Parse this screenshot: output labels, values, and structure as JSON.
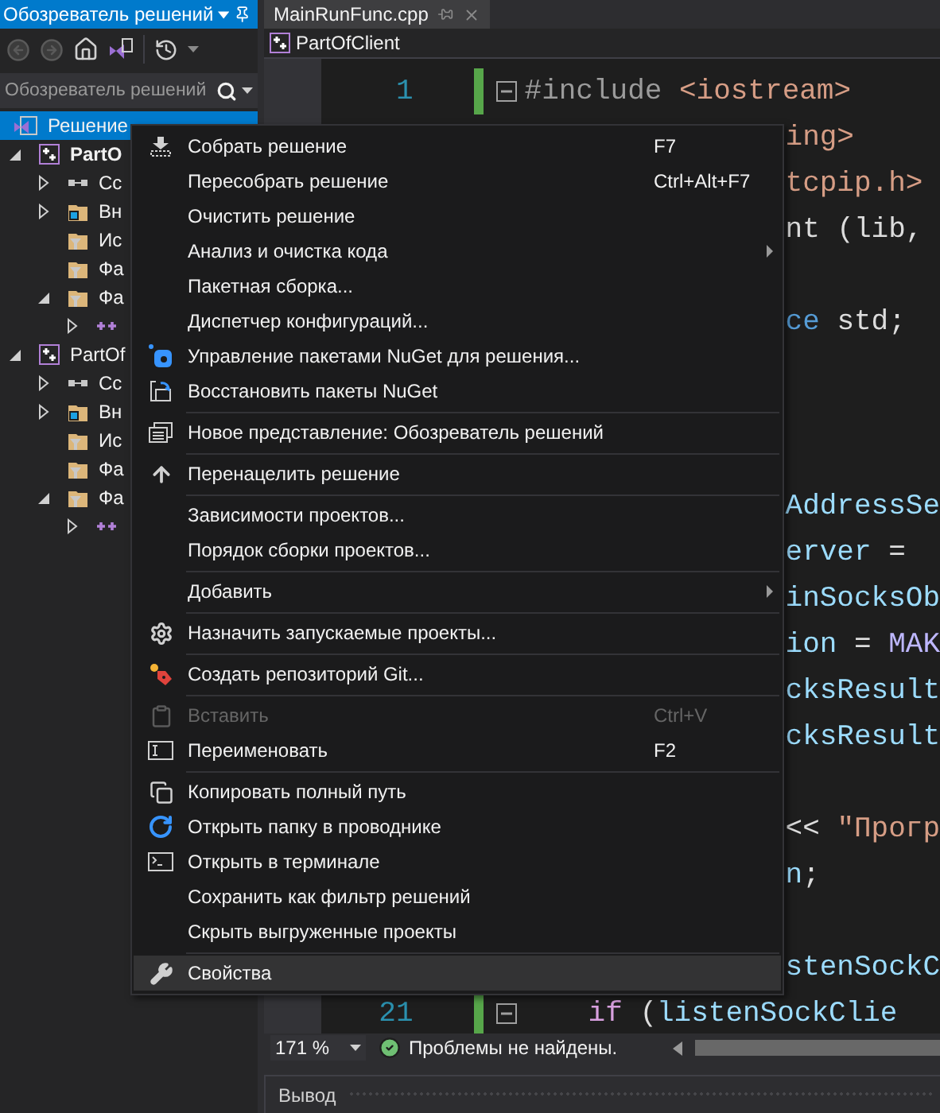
{
  "explorer": {
    "title": "Обозреватель решений",
    "search": {
      "placeholder": "Обозреватель решений"
    },
    "tree": [
      {
        "kind": "solution",
        "label": "Решение",
        "selected": true,
        "children": [
          {
            "kind": "project",
            "label": "PartO",
            "startup": true,
            "expanded": true,
            "selected": false,
            "children": [
              {
                "kind": "references",
                "label": "Сс",
                "expanded": false,
                "selected": false
              },
              {
                "kind": "external",
                "label": "Вн",
                "expanded": false,
                "selected": false
              },
              {
                "kind": "filter",
                "label": "Ис",
                "selected": false
              },
              {
                "kind": "filter",
                "label": "Фа",
                "selected": false
              },
              {
                "kind": "filter",
                "label": "Фа",
                "expanded": true,
                "selected": false,
                "children": [
                  {
                    "kind": "source",
                    "expanded": false,
                    "selected": false
                  }
                ]
              }
            ]
          },
          {
            "kind": "project",
            "label": "PartOf",
            "startup": false,
            "expanded": true,
            "selected": false,
            "children": [
              {
                "kind": "references",
                "label": "Сс",
                "expanded": false,
                "selected": false
              },
              {
                "kind": "external",
                "label": "Вн",
                "expanded": false,
                "selected": false
              },
              {
                "kind": "filter",
                "label": "Ис",
                "selected": false
              },
              {
                "kind": "filter",
                "label": "Фа",
                "selected": false
              },
              {
                "kind": "filter",
                "label": "Фа",
                "expanded": true,
                "selected": false,
                "children": [
                  {
                    "kind": "source",
                    "expanded": false,
                    "selected": false
                  }
                ]
              }
            ]
          }
        ]
      }
    ]
  },
  "editor": {
    "tab": {
      "label": "MainRunFunc.cpp"
    },
    "nav": {
      "project": "PartOfClient"
    },
    "lines": [
      {
        "kind": "full",
        "number": "1",
        "fold": true,
        "changed": true,
        "segments": [
          {
            "kind": "preprocessor",
            "text": "#include"
          },
          {
            "kind": "string",
            "text": " <iostream>"
          }
        ]
      },
      {
        "kind": "tail",
        "segments": [
          {
            "kind": "string",
            "text": "ing>"
          }
        ]
      },
      {
        "kind": "tail",
        "segments": [
          {
            "kind": "string",
            "text": "tcpip.h>"
          }
        ]
      },
      {
        "kind": "tail",
        "segments": [
          {
            "kind": "plain",
            "text": "nt (lib,"
          }
        ]
      },
      {
        "kind": "blank"
      },
      {
        "kind": "tail",
        "segments": [
          {
            "kind": "keyword",
            "text": "ce"
          },
          {
            "kind": "plain",
            "text": " std;"
          }
        ]
      },
      {
        "kind": "blank"
      },
      {
        "kind": "blank"
      },
      {
        "kind": "blank"
      },
      {
        "kind": "tail",
        "segments": [
          {
            "kind": "variable",
            "text": "AddressSe"
          }
        ]
      },
      {
        "kind": "tail",
        "segments": [
          {
            "kind": "variable",
            "text": "erver"
          },
          {
            "kind": "plain",
            "text": " ="
          }
        ]
      },
      {
        "kind": "tail",
        "segments": [
          {
            "kind": "variable",
            "text": "inSocksOb"
          }
        ]
      },
      {
        "kind": "tail",
        "segments": [
          {
            "kind": "variable",
            "text": "ion"
          },
          {
            "kind": "plain",
            "text": " = "
          },
          {
            "kind": "macro",
            "text": "MAK"
          }
        ]
      },
      {
        "kind": "tail",
        "segments": [
          {
            "kind": "variable",
            "text": "cksResult"
          }
        ]
      },
      {
        "kind": "tail",
        "segments": [
          {
            "kind": "variable",
            "text": "cksResult"
          }
        ]
      },
      {
        "kind": "blank"
      },
      {
        "kind": "tail",
        "segments": [
          {
            "kind": "plain",
            "text": "<< "
          },
          {
            "kind": "string",
            "text": "\"Прогр"
          }
        ]
      },
      {
        "kind": "tail",
        "segments": [
          {
            "kind": "variable",
            "text": "n"
          },
          {
            "kind": "plain",
            "text": ";"
          }
        ]
      },
      {
        "kind": "blank"
      },
      {
        "kind": "tail",
        "segments": [
          {
            "kind": "variable",
            "text": "stenSockC"
          }
        ]
      },
      {
        "kind": "indented",
        "number": "21",
        "fold": true,
        "changed": true,
        "segments": [
          {
            "kind": "control",
            "text": "if"
          },
          {
            "kind": "plain",
            "text": " ("
          },
          {
            "kind": "variable",
            "text": "listenSockClie"
          }
        ]
      }
    ],
    "status": {
      "zoom": "171 %",
      "issues": "Проблемы не найдены."
    }
  },
  "output": {
    "title": "Вывод"
  },
  "context_menu": {
    "items": [
      {
        "kind": "item",
        "label": "Собрать решение",
        "shortcut": "F7",
        "submenu": false,
        "disabled": false,
        "selected": false
      },
      {
        "kind": "item",
        "label": "Пересобрать решение",
        "shortcut": "Ctrl+Alt+F7",
        "submenu": false,
        "disabled": false,
        "selected": false
      },
      {
        "kind": "item",
        "label": "Очистить решение",
        "submenu": false,
        "disabled": false,
        "selected": false
      },
      {
        "kind": "item",
        "label": "Анализ и очистка кода",
        "submenu": true,
        "disabled": false,
        "selected": false
      },
      {
        "kind": "item",
        "label": "Пакетная сборка...",
        "submenu": false,
        "disabled": false,
        "selected": false
      },
      {
        "kind": "item",
        "label": "Диспетчер конфигураций...",
        "submenu": false,
        "disabled": false,
        "selected": false
      },
      {
        "kind": "item",
        "label": "Управление пакетами NuGet для решения...",
        "submenu": false,
        "disabled": false,
        "selected": false
      },
      {
        "kind": "item",
        "label": "Восстановить пакеты NuGet",
        "submenu": false,
        "disabled": false,
        "selected": false
      },
      {
        "kind": "separator"
      },
      {
        "kind": "item",
        "label": "Новое представление: Обозреватель решений",
        "submenu": false,
        "disabled": false,
        "selected": false
      },
      {
        "kind": "separator"
      },
      {
        "kind": "item",
        "label": "Перенацелить решение",
        "submenu": false,
        "disabled": false,
        "selected": false
      },
      {
        "kind": "separator"
      },
      {
        "kind": "item",
        "label": "Зависимости проектов...",
        "submenu": false,
        "disabled": false,
        "selected": false
      },
      {
        "kind": "item",
        "label": "Порядок сборки проектов...",
        "submenu": false,
        "disabled": false,
        "selected": false
      },
      {
        "kind": "separator"
      },
      {
        "kind": "item",
        "label": "Добавить",
        "submenu": true,
        "disabled": false,
        "selected": false
      },
      {
        "kind": "separator"
      },
      {
        "kind": "item",
        "label": "Назначить запускаемые проекты...",
        "submenu": false,
        "disabled": false,
        "selected": false
      },
      {
        "kind": "separator"
      },
      {
        "kind": "item",
        "label": "Создать репозиторий Git...",
        "submenu": false,
        "disabled": false,
        "selected": false
      },
      {
        "kind": "separator"
      },
      {
        "kind": "item",
        "label": "Вставить",
        "shortcut": "Ctrl+V",
        "submenu": false,
        "disabled": true,
        "selected": false
      },
      {
        "kind": "item",
        "label": "Переименовать",
        "shortcut": "F2",
        "submenu": false,
        "disabled": false,
        "selected": false
      },
      {
        "kind": "separator"
      },
      {
        "kind": "item",
        "label": "Копировать полный путь",
        "submenu": false,
        "disabled": false,
        "selected": false
      },
      {
        "kind": "item",
        "label": "Открыть папку в проводнике",
        "submenu": false,
        "disabled": false,
        "selected": false
      },
      {
        "kind": "item",
        "label": "Открыть в терминале",
        "submenu": false,
        "disabled": false,
        "selected": false
      },
      {
        "kind": "item",
        "label": "Сохранить как фильтр решений",
        "submenu": false,
        "disabled": false,
        "selected": false
      },
      {
        "kind": "item",
        "label": "Скрыть выгруженные проекты",
        "submenu": false,
        "disabled": false,
        "selected": false
      },
      {
        "kind": "separator"
      },
      {
        "kind": "item",
        "label": "Свойства",
        "submenu": false,
        "disabled": false,
        "selected": true
      }
    ]
  }
}
